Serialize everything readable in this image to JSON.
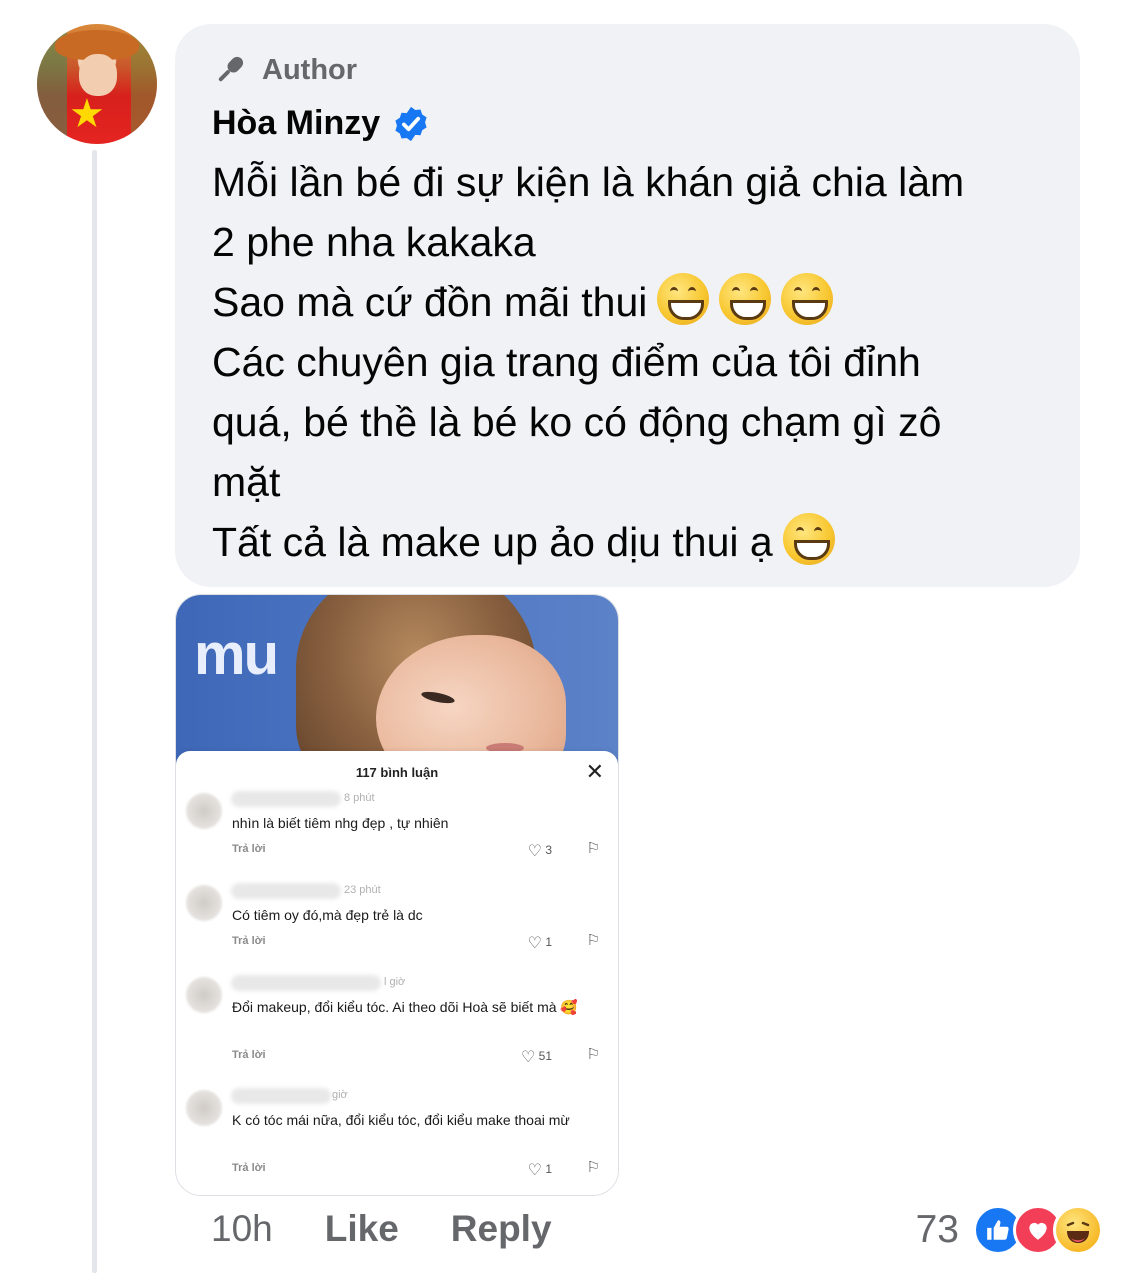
{
  "comment": {
    "badge_label": "Author",
    "author_name": "Hòa Minzy",
    "message_lines": [
      "Mỗi lần bé đi sự kiện là khán giả chia làm",
      "2 phe nha kakaka",
      "Sao mà cứ đồn mãi thui",
      "Các chuyên gia trang điểm của tôi đỉnh",
      "quá, bé thề là bé ko có động chạm gì zô",
      "mặt",
      "Tất cả là make up ảo dịu thui ạ"
    ],
    "timestamp": "10h",
    "like_label": "Like",
    "reply_label": "Reply",
    "reaction_count": "73",
    "reactions": [
      "like-icon",
      "love-icon",
      "haha-icon"
    ]
  },
  "attachment": {
    "photo_logo": "mu",
    "sheet_title": "117 bình luận",
    "comments": [
      {
        "time": "8 phút",
        "text": "nhìn là biết tiêm nhg đẹp , tự nhiên",
        "reply": "Trả lời",
        "likes": "3"
      },
      {
        "time": "23 phút",
        "text": "Có tiêm oy đó,mà đẹp trẻ là dc",
        "reply": "Trả lời",
        "likes": "1"
      },
      {
        "time": "l giờ",
        "text": "Đổi makeup, đổi kiểu tóc. Ai theo dõi Hoà sẽ biết mà 🥰",
        "reply": "Trả lời",
        "likes": "51"
      },
      {
        "time": "giờ",
        "text": "K có tóc mái nữa, đổi kiểu tóc, đổi kiểu make thoai mừ",
        "reply": "Trả lời",
        "likes": "1"
      }
    ]
  },
  "colors": {
    "bubble": "#f0f2f5",
    "secondary_text": "#65676b",
    "verified": "#1877f2",
    "love": "#f33e58"
  }
}
